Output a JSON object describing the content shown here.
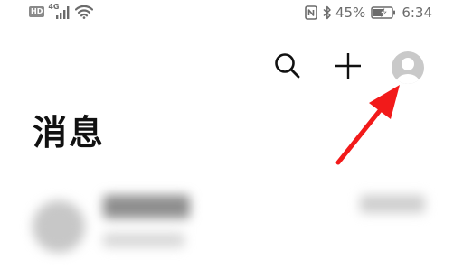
{
  "status_bar": {
    "hd_label": "HD",
    "network_type": "4G",
    "battery_percent": "45%",
    "time": "6:34",
    "icons": [
      "hd-icon",
      "signal-icon",
      "wifi-icon",
      "nfc-icon",
      "bluetooth-icon",
      "battery-charging-icon"
    ]
  },
  "toolbar": {
    "icons": [
      "search-icon",
      "plus-icon",
      "avatar-icon"
    ]
  },
  "page": {
    "title": "消息"
  },
  "annotation": {
    "color": "#f21a1a",
    "icon": "red-arrow-pointing-to-avatar"
  },
  "colors": {
    "status_text": "#6b6b6b",
    "title_text": "#111111",
    "avatar_bg": "#c9c9c9"
  }
}
